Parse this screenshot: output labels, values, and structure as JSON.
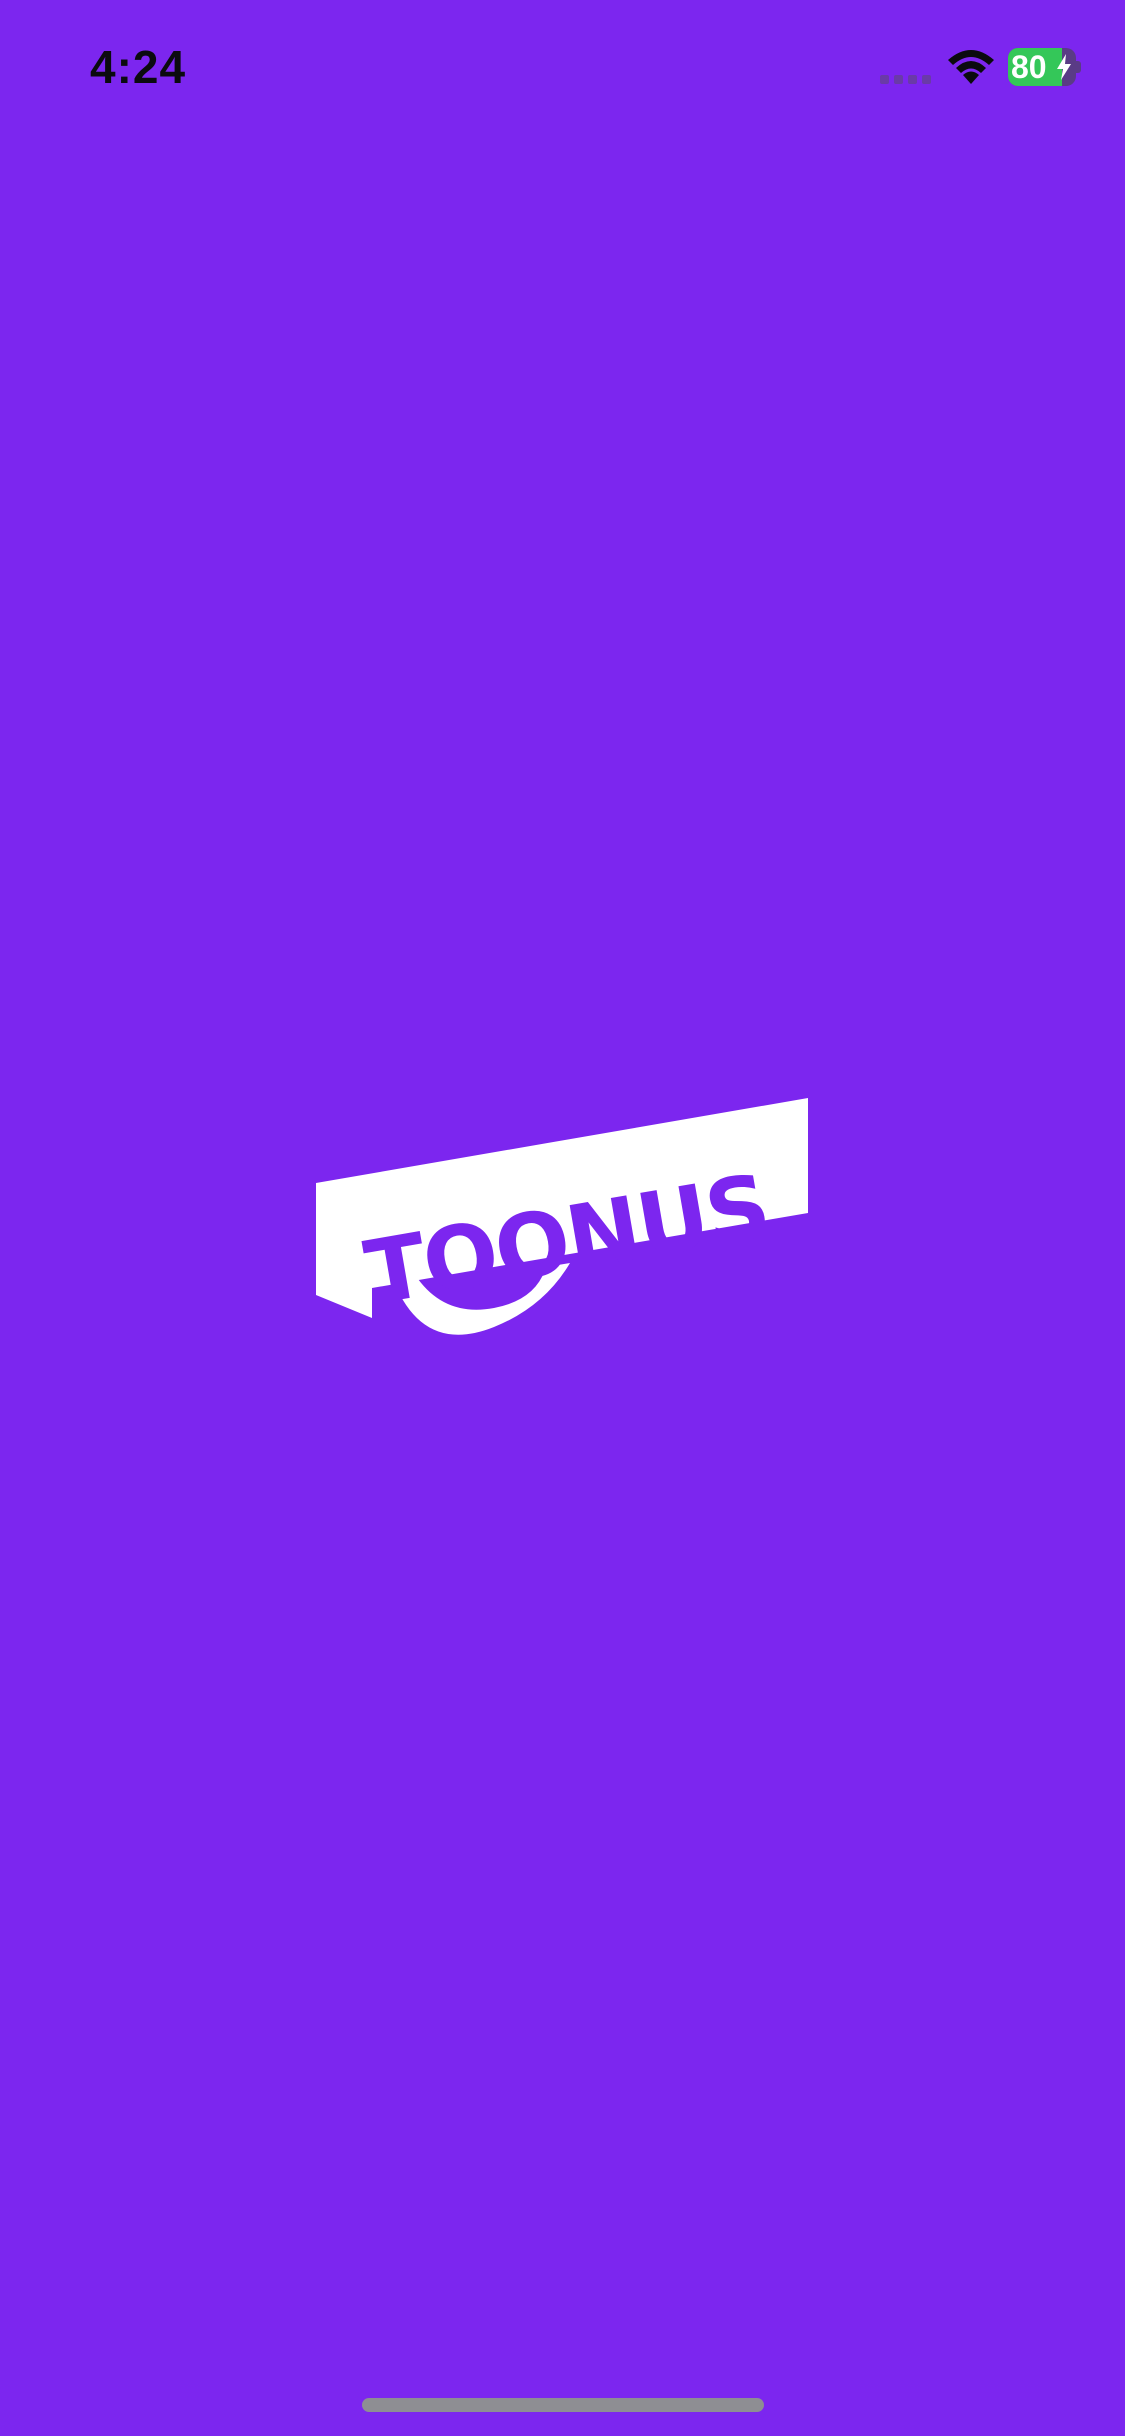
{
  "status_bar": {
    "time": "4:24",
    "battery_level": "80",
    "battery_fraction": 0.8,
    "battery_charging": true,
    "signal_icon": "cellular-signal-icon",
    "wifi_icon": "wifi-icon",
    "bolt_icon": "charging-bolt-icon"
  },
  "splash": {
    "logo_text": "TOONUS",
    "logo_icon": "toonus-logo",
    "background_color": "#7c26ef",
    "logo_color": "#ffffff"
  },
  "home_indicator": {
    "color": "#8e8e93"
  }
}
